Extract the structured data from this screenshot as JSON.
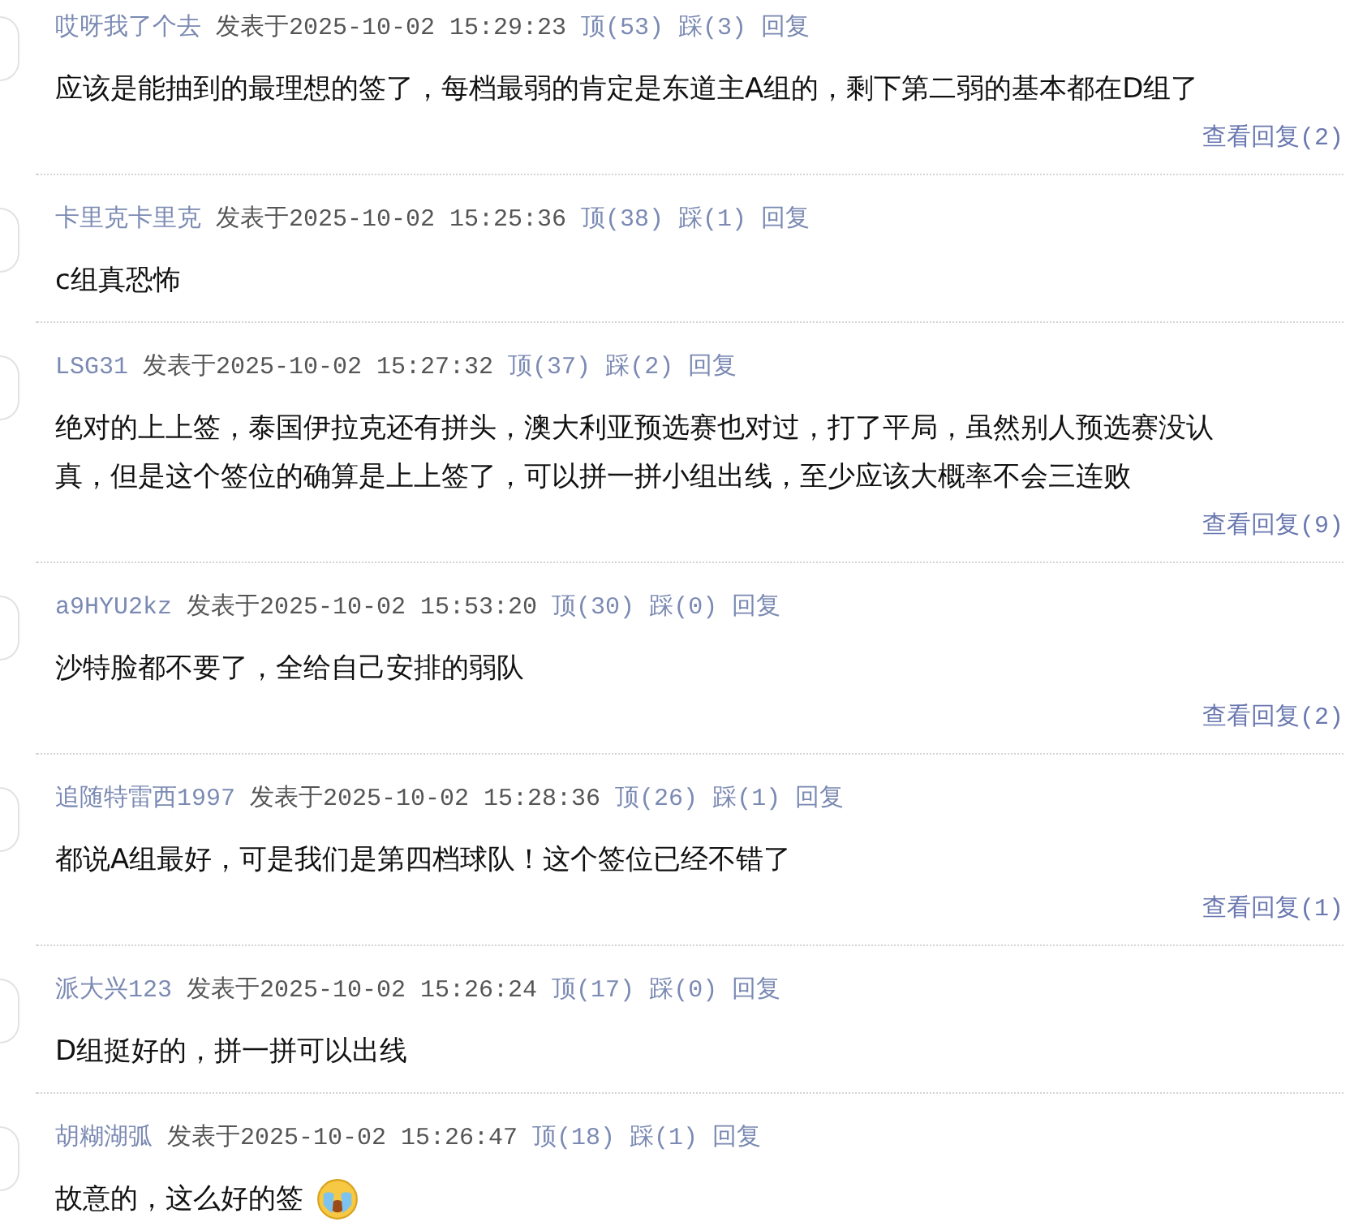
{
  "comments": [
    {
      "user": "哎呀我了个去",
      "posted": "发表于2025-10-02 15:29:23",
      "up": "顶(53)",
      "down": "踩(3)",
      "reply": "回复",
      "body": "应该是能抽到的最理想的签了，每档最弱的肯定是东道主A组的，剩下第二弱的基本都在D组了",
      "replies": "查看回复(2)"
    },
    {
      "user": "卡里克卡里克",
      "posted": "发表于2025-10-02 15:25:36",
      "up": "顶(38)",
      "down": "踩(1)",
      "reply": "回复",
      "body": "c组真恐怖"
    },
    {
      "user": "LSG31",
      "posted": "发表于2025-10-02 15:27:32",
      "up": "顶(37)",
      "down": "踩(2)",
      "reply": "回复",
      "body": "绝对的上上签，泰国伊拉克还有拼头，澳大利亚预选赛也对过，打了平局，虽然别人预选赛没认真，但是这个签位的确算是上上签了，可以拼一拼小组出线，至少应该大概率不会三连败",
      "replies": "查看回复(9)"
    },
    {
      "user": "a9HYU2kz",
      "posted": "发表于2025-10-02 15:53:20",
      "up": "顶(30)",
      "down": "踩(0)",
      "reply": "回复",
      "body": "沙特脸都不要了，全给自己安排的弱队",
      "replies": "查看回复(2)"
    },
    {
      "user": "追随特雷西1997",
      "posted": "发表于2025-10-02 15:28:36",
      "up": "顶(26)",
      "down": "踩(1)",
      "reply": "回复",
      "body": "都说A组最好，可是我们是第四档球队！这个签位已经不错了",
      "replies": "查看回复(1)"
    },
    {
      "user": "派大兴123",
      "posted": "发表于2025-10-02 15:26:24",
      "up": "顶(17)",
      "down": "踩(0)",
      "reply": "回复",
      "body": "D组挺好的，拼一拼可以出线"
    },
    {
      "user": "胡糊湖弧",
      "posted": "发表于2025-10-02 15:26:47",
      "up": "顶(18)",
      "down": "踩(1)",
      "reply": "回复",
      "body": "故意的，这么好的签",
      "emoji": true
    }
  ]
}
